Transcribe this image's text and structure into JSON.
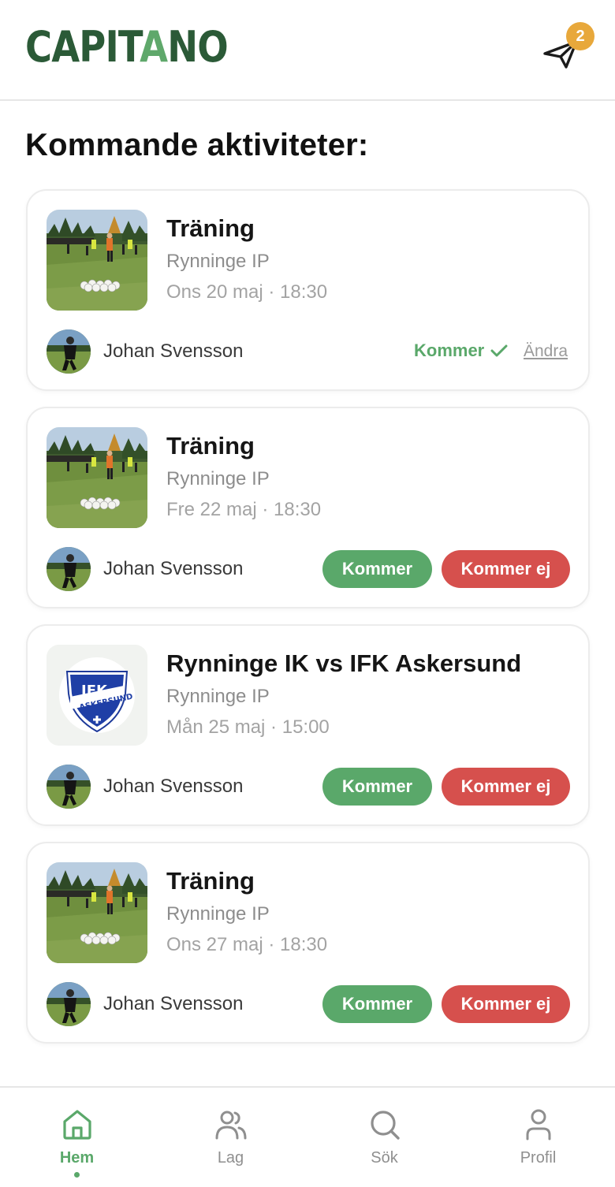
{
  "app": {
    "logo_prefix": "CAPIT",
    "logo_accent": "A",
    "logo_suffix": "NO",
    "notification_count": "2",
    "notification_icon": "send-icon"
  },
  "colors": {
    "brand_dark": "#2b5a37",
    "brand_accent": "#5fa86b",
    "accept": "#5aa86a",
    "decline": "#d6504d",
    "badge": "#e8a83b"
  },
  "section_title": "Kommande aktiviteter:",
  "activities": [
    {
      "title": "Träning",
      "place": "Rynninge IP",
      "datetime": "Ons 20 maj · 18:30",
      "organizer": "Johan Svensson",
      "status": "Kommer",
      "change_label": "Ändra",
      "image": "training-photo"
    },
    {
      "title": "Träning",
      "place": "Rynninge IP",
      "datetime": "Fre 22 maj · 18:30",
      "organizer": "Johan Svensson",
      "accept_label": "Kommer",
      "decline_label": "Kommer ej",
      "image": "training-photo"
    },
    {
      "title": "Rynninge IK vs IFK Askersund",
      "place": "Rynninge IP",
      "datetime": "Mån 25 maj · 15:00",
      "organizer": "Johan Svensson",
      "accept_label": "Kommer",
      "decline_label": "Kommer ej",
      "image": "ifk-askersund-crest",
      "crest_top": "IFK",
      "crest_band": "ASKERSUND"
    },
    {
      "title": "Träning",
      "place": "Rynninge IP",
      "datetime": "Ons 27 maj · 18:30",
      "organizer": "Johan Svensson",
      "accept_label": "Kommer",
      "decline_label": "Kommer ej",
      "image": "training-photo"
    }
  ],
  "nav": [
    {
      "label": "Hem",
      "icon": "home-icon",
      "active": true
    },
    {
      "label": "Lag",
      "icon": "team-icon",
      "active": false
    },
    {
      "label": "Sök",
      "icon": "search-icon",
      "active": false
    },
    {
      "label": "Profil",
      "icon": "profile-icon",
      "active": false
    }
  ]
}
